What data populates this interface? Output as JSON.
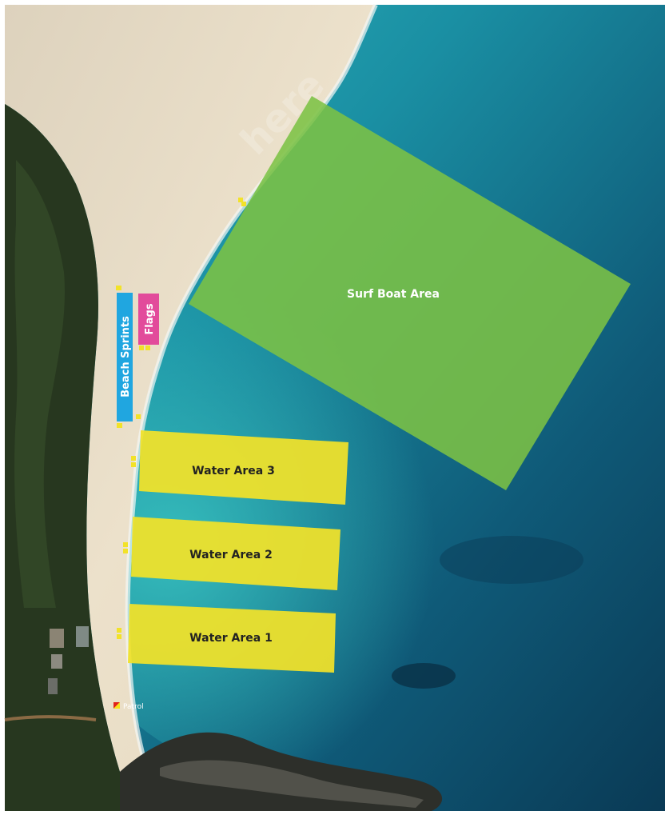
{
  "watermark": "here",
  "zones": {
    "surf_boat": {
      "label": "Surf Boat Area",
      "color": "#7cc244"
    },
    "water_3": {
      "label": "Water Area 3",
      "color": "#f2e229"
    },
    "water_2": {
      "label": "Water Area 2",
      "color": "#f2e229"
    },
    "water_1": {
      "label": "Water Area 1",
      "color": "#f2e229"
    },
    "beach_sprints": {
      "label": "Beach Sprints",
      "color": "#20a6e0"
    },
    "flags": {
      "label": "Flags",
      "color": "#e24b9b"
    }
  },
  "patrol": {
    "label": "Patrol",
    "flag_colors": [
      "#e2231a",
      "#f7e21b"
    ]
  },
  "colors": {
    "sand": "#e9ddc6",
    "forest": "#2a3a22",
    "shallow_water": "#2fa8b0",
    "deep_water": "#0c3f5a",
    "marker": "#f2e229"
  }
}
